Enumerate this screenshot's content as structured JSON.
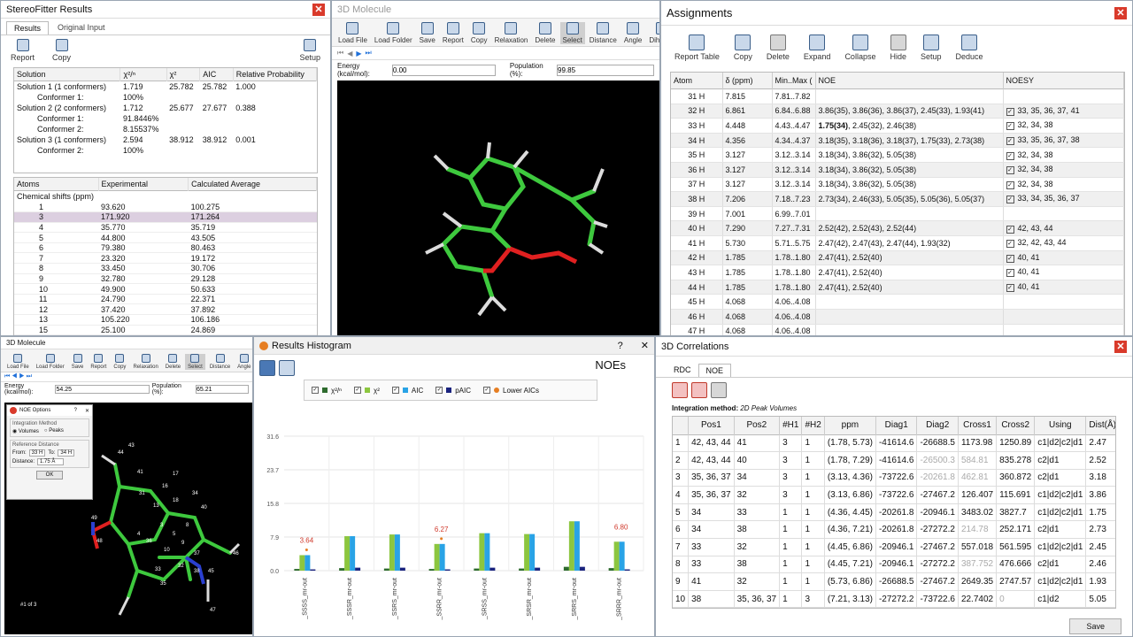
{
  "sf": {
    "title": "StereoFitter Results",
    "tabs": [
      "Results",
      "Original Input"
    ],
    "tools": [
      "Report",
      "Copy",
      "Setup"
    ],
    "sol_headers": [
      "Solution",
      "χ²/ⁿ",
      "χ²",
      "AIC",
      "Relative Probability"
    ],
    "sol_rows": [
      [
        "Solution 1 (1 conformers)",
        "1.719",
        "25.782",
        "25.782",
        "1.000"
      ],
      [
        "Conformer 1:",
        "100%",
        "",
        "",
        ""
      ],
      [
        "Solution 2 (2 conformers)",
        "1.712",
        "25.677",
        "27.677",
        "0.388"
      ],
      [
        "Conformer 1:",
        "91.8446%",
        "",
        "",
        ""
      ],
      [
        "Conformer 2:",
        "8.15537%",
        "",
        "",
        ""
      ],
      [
        "Solution 3 (1 conformers)",
        "2.594",
        "38.912",
        "38.912",
        "0.001"
      ],
      [
        "Conformer 2:",
        "100%",
        "",
        "",
        ""
      ]
    ],
    "atom_headers": [
      "Atoms",
      "Experimental",
      "Calculated Average"
    ],
    "chem_label": "Chemical shifts (ppm)",
    "atom_rows": [
      [
        "1",
        "93.620",
        "100.275"
      ],
      [
        "3",
        "171.920",
        "171.264"
      ],
      [
        "4",
        "35.770",
        "35.719"
      ],
      [
        "5",
        "44.800",
        "43.505"
      ],
      [
        "6",
        "79.380",
        "80.463"
      ],
      [
        "7",
        "23.320",
        "19.172"
      ],
      [
        "8",
        "33.450",
        "30.706"
      ],
      [
        "9",
        "32.780",
        "29.128"
      ],
      [
        "10",
        "49.900",
        "50.633"
      ],
      [
        "11",
        "24.790",
        "22.371"
      ],
      [
        "12",
        "37.420",
        "37.892"
      ],
      [
        "13",
        "105.220",
        "106.186"
      ],
      [
        "15",
        "25.100",
        "24.869"
      ]
    ]
  },
  "mol": {
    "title": "3D Molecule",
    "tools": [
      "Load File",
      "Load Folder",
      "Save",
      "Report",
      "Copy",
      "Relaxation",
      "Delete",
      "Select",
      "Distance",
      "Angle",
      "Dihedral"
    ],
    "energy_label": "Energy (kcal/mol):",
    "energy": "0.00",
    "pop_label": "Population (%):",
    "pop": "99.85"
  },
  "asg": {
    "title": "Assignments",
    "tools": [
      "Report Table",
      "Copy",
      "Delete",
      "Expand",
      "Collapse",
      "Hide",
      "Setup",
      "Deduce"
    ],
    "headers": [
      "Atom",
      "δ (ppm)",
      "Min..Max (",
      "NOE",
      "NOESY"
    ],
    "rows": [
      [
        "31 H",
        "7.815",
        "7.81..7.82",
        "",
        ""
      ],
      [
        "32 H",
        "6.861",
        "6.84..6.88",
        "3.86(35), 3.86(36), 3.86(37), 2.45(33), 1.93(41)",
        "33, 35, 36, 37, 41"
      ],
      [
        "33 H",
        "4.448",
        "4.43..4.47",
        "1.75(34), 2.45(32), 2.46(38)",
        "32, 34, 38"
      ],
      [
        "34 H",
        "4.356",
        "4.34..4.37",
        "3.18(35), 3.18(36), 3.18(37), 1.75(33), 2.73(38)",
        "33, 35, 36, 37, 38"
      ],
      [
        "35 H",
        "3.127",
        "3.12..3.14",
        "3.18(34), 3.86(32), 5.05(38)",
        "32, 34, 38"
      ],
      [
        "36 H",
        "3.127",
        "3.12..3.14",
        "3.18(34), 3.86(32), 5.05(38)",
        "32, 34, 38"
      ],
      [
        "37 H",
        "3.127",
        "3.12..3.14",
        "3.18(34), 3.86(32), 5.05(38)",
        "32, 34, 38"
      ],
      [
        "38 H",
        "7.206",
        "7.18..7.23",
        "2.73(34), 2.46(33), 5.05(35), 5.05(36), 5.05(37)",
        "33, 34, 35, 36, 37"
      ],
      [
        "39 H",
        "7.001",
        "6.99..7.01",
        "",
        ""
      ],
      [
        "40 H",
        "7.290",
        "7.27..7.31",
        "2.52(42), 2.52(43), 2.52(44)",
        "42, 43, 44"
      ],
      [
        "41 H",
        "5.730",
        "5.71..5.75",
        "2.47(42), 2.47(43), 2.47(44), 1.93(32)",
        "32, 42, 43, 44"
      ],
      [
        "42 H",
        "1.785",
        "1.78..1.80",
        "2.47(41), 2.52(40)",
        "40, 41"
      ],
      [
        "43 H",
        "1.785",
        "1.78..1.80",
        "2.47(41), 2.52(40)",
        "40, 41"
      ],
      [
        "44 H",
        "1.785",
        "1.78..1.80",
        "2.47(41), 2.52(40)",
        "40, 41"
      ],
      [
        "45 H",
        "4.068",
        "4.06..4.08",
        "",
        ""
      ],
      [
        "46 H",
        "4.068",
        "4.06..4.08",
        "",
        ""
      ],
      [
        "47 H",
        "4.068",
        "4.06..4.08",
        "",
        ""
      ]
    ]
  },
  "mol2": {
    "title": "3D Molecule",
    "tools": [
      "Load File",
      "Load Folder",
      "Save",
      "Report",
      "Copy",
      "Relaxation",
      "Delete",
      "Select",
      "Distance",
      "Angle",
      "Dihe"
    ],
    "energy_label": "Energy (kcal/mol):",
    "energy": "54.25",
    "pop_label": "Population (%):",
    "pop": "65.21",
    "footer": "#1 of 3",
    "labels": [
      "43",
      "44",
      "41",
      "17",
      "16",
      "31",
      "34",
      "40",
      "18",
      "13",
      "3",
      "4",
      "5",
      "8",
      "9",
      "10",
      "36",
      "37",
      "32",
      "38",
      "33",
      "35",
      "46",
      "49",
      "48",
      "45",
      "47"
    ]
  },
  "noe": {
    "title": "NOE Options",
    "q": "?",
    "method_label": "Integration Method",
    "volumes": "Volumes",
    "peaks": "Peaks",
    "ref_label": "Reference Distance",
    "from_label": "From:",
    "from": "33 H",
    "to_label": "To:",
    "to": "34 H",
    "dist_label": "Distance:",
    "dist": "1.75 Å",
    "ok": "OK"
  },
  "hist": {
    "title": "Results Histogram",
    "q": "?",
    "close": "✕",
    "heading": "NOEs",
    "legend": [
      "χ²/ⁿ",
      "χ²",
      "AIC",
      "pAIC",
      "Lower AICs"
    ],
    "colors": {
      "dark_green": "#2e6b2e",
      "light_green": "#8cc63f",
      "blue": "#29a3e6",
      "navy": "#1a237e",
      "orange": "#e67e22"
    }
  },
  "chart_data": {
    "type": "bar",
    "categories": [
      "_SSSS_mr-out",
      "_SSSR_mr-out",
      "_SSRS_mr-out",
      "_SSRR_mr-out",
      "_SRSS_mr-out",
      "_SRSR_mr-out",
      "_SRRS_mr-out",
      "_SRRR_mr-out"
    ],
    "ylim": [
      0,
      31.6
    ],
    "yticks": [
      "31.6",
      "23.7",
      "15.8",
      "7.9",
      "0.0"
    ],
    "series": [
      {
        "name": "χ²/ⁿ",
        "values": [
          0.4,
          0.6,
          0.5,
          0.4,
          0.5,
          0.5,
          0.9,
          0.6
        ]
      },
      {
        "name": "χ²",
        "values": [
          3.64,
          8.1,
          8.5,
          6.27,
          8.8,
          8.6,
          11.6,
          6.8
        ]
      },
      {
        "name": "AIC",
        "values": [
          3.64,
          8.1,
          8.5,
          6.27,
          8.8,
          8.6,
          11.6,
          6.8
        ]
      },
      {
        "name": "pAIC",
        "values": [
          0.3,
          0.7,
          0.7,
          0.3,
          0.7,
          0.7,
          0.9,
          0.3
        ]
      }
    ],
    "annotations": [
      "3.64",
      "6.27",
      "6.80"
    ]
  },
  "corr": {
    "title": "3D Correlations",
    "tabs": [
      "RDC",
      "NOE"
    ],
    "method_label": "Integration method:",
    "method": "2D Peak Volumes",
    "headers": [
      "",
      "Pos1",
      "Pos2",
      "#H1",
      "#H2",
      "ppm",
      "Diag1",
      "Diag2",
      "Cross1",
      "Cross2",
      "Using",
      "Dist(Å)"
    ],
    "rows": [
      [
        "1",
        "42, 43, 44",
        "41",
        "3",
        "1",
        "(1.78, 5.73)",
        "-41614.6",
        "-26688.5",
        "1173.98",
        "1250.89",
        "c1|d2|c2|d1",
        "2.47"
      ],
      [
        "2",
        "42, 43, 44",
        "40",
        "3",
        "1",
        "(1.78, 7.29)",
        "-41614.6",
        "-26500.3",
        "584.81",
        "835.278",
        "c2|d1",
        "2.52"
      ],
      [
        "3",
        "35, 36, 37",
        "34",
        "3",
        "1",
        "(3.13, 4.36)",
        "-73722.6",
        "-20261.8",
        "462.81",
        "360.872",
        "c2|d1",
        "3.18"
      ],
      [
        "4",
        "35, 36, 37",
        "32",
        "3",
        "1",
        "(3.13, 6.86)",
        "-73722.6",
        "-27467.2",
        "126.407",
        "115.691",
        "c1|d2|c2|d1",
        "3.86"
      ],
      [
        "5",
        "34",
        "33",
        "1",
        "1",
        "(4.36, 4.45)",
        "-20261.8",
        "-20946.1",
        "3483.02",
        "3827.7",
        "c1|d2|c2|d1",
        "1.75"
      ],
      [
        "6",
        "34",
        "38",
        "1",
        "1",
        "(4.36, 7.21)",
        "-20261.8",
        "-27272.2",
        "214.78",
        "252.171",
        "c2|d1",
        "2.73"
      ],
      [
        "7",
        "33",
        "32",
        "1",
        "1",
        "(4.45, 6.86)",
        "-20946.1",
        "-27467.2",
        "557.018",
        "561.595",
        "c1|d2|c2|d1",
        "2.45"
      ],
      [
        "8",
        "33",
        "38",
        "1",
        "1",
        "(4.45, 7.21)",
        "-20946.1",
        "-27272.2",
        "387.752",
        "476.666",
        "c2|d1",
        "2.46"
      ],
      [
        "9",
        "41",
        "32",
        "1",
        "1",
        "(5.73, 6.86)",
        "-26688.5",
        "-27467.2",
        "2649.35",
        "2747.57",
        "c1|d2|c2|d1",
        "1.93"
      ],
      [
        "10",
        "38",
        "35, 36, 37",
        "1",
        "3",
        "(7.21, 3.13)",
        "-27272.2",
        "-73722.6",
        "22.7402",
        "0",
        "c1|d2",
        "5.05"
      ]
    ],
    "save": "Save"
  }
}
